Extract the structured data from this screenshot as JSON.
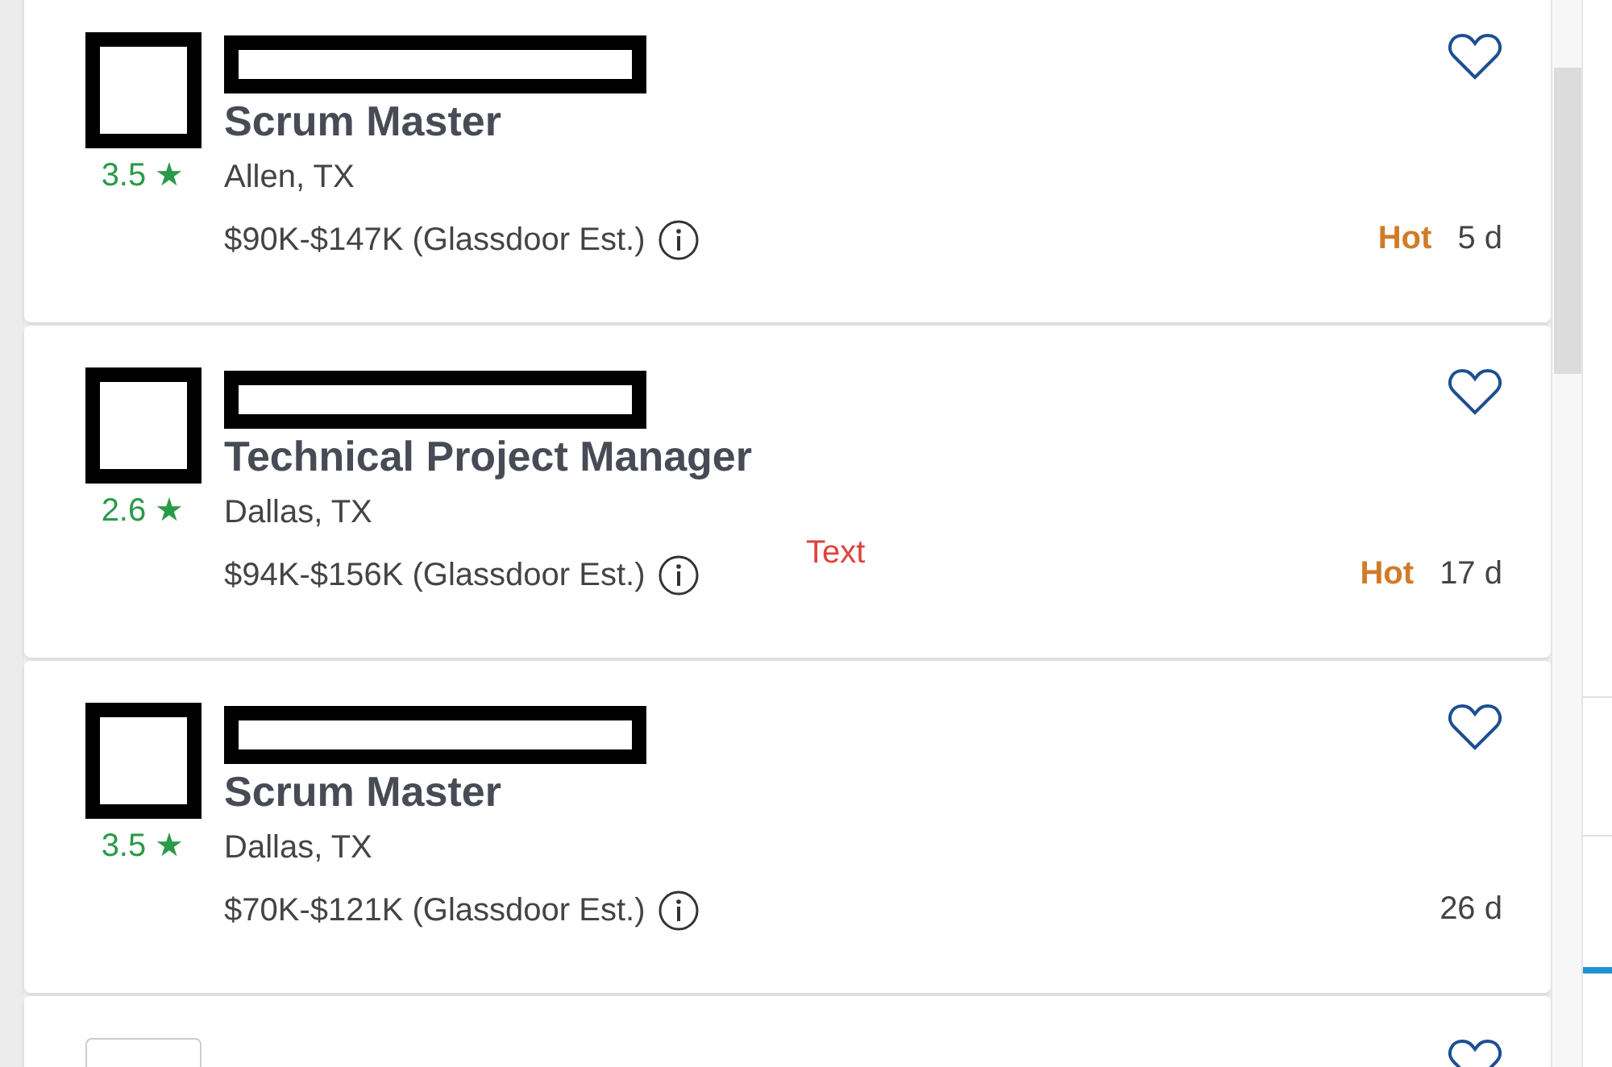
{
  "jobs": [
    {
      "kind": "full",
      "rating": "3.5 ★",
      "title": "Scrum Master",
      "location": "Allen, TX",
      "salary": "$90K-$147K (Glassdoor Est.)",
      "hot": "Hot",
      "age": "5 d",
      "saved": false
    },
    {
      "kind": "full",
      "rating": "2.6 ★",
      "title": "Technical Project Manager",
      "location": "Dallas, TX",
      "salary": "$94K-$156K (Glassdoor Est.)",
      "hot": "Hot",
      "age": "17 d",
      "saved": false,
      "annotation": "Text"
    },
    {
      "kind": "full",
      "rating": "3.5 ★",
      "title": "Scrum Master",
      "location": "Dallas, TX",
      "salary": "$70K-$121K (Glassdoor Est.)",
      "age": "26 d",
      "saved": false
    },
    {
      "kind": "partial",
      "saved": false
    }
  ]
}
